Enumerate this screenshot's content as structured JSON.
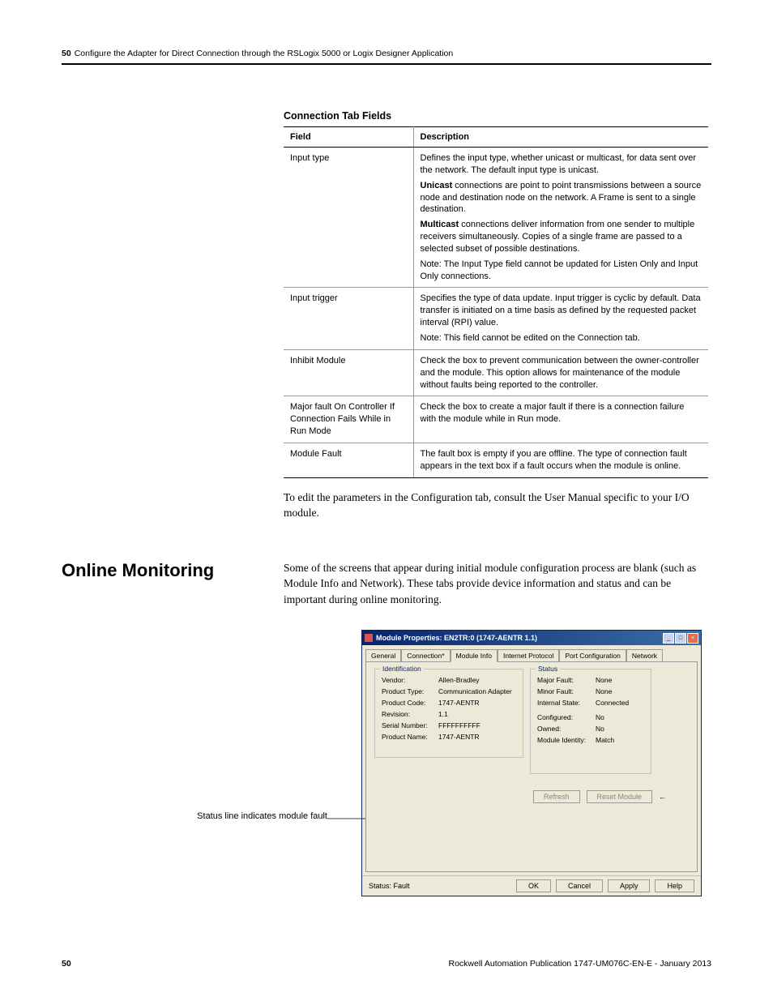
{
  "header": {
    "page_num": "50",
    "chapter": "Configure the Adapter for Direct Connection through the RSLogix 5000 or Logix Designer Application"
  },
  "table": {
    "caption": "Connection Tab Fields",
    "head": {
      "field": "Field",
      "desc": "Description"
    },
    "rows": [
      {
        "field": "Input type",
        "desc": [
          "Defines the input type, whether unicast or multicast, for data sent over the network. The default input type is unicast.",
          "<b>Unicast</b> connections are point to point transmissions between a source node and destination node on the network. A Frame is sent to a single destination.",
          "<b>Multicast</b> connections deliver information from one sender to multiple receivers simultaneously. Copies of a single frame are passed to a selected subset of possible destinations.",
          "Note: The Input Type field cannot be updated for Listen Only and Input Only connections."
        ]
      },
      {
        "field": "Input trigger",
        "desc": [
          "Specifies the type of data update. Input trigger is cyclic by default. Data transfer is initiated on a time basis as defined by the requested packet interval (RPI) value.",
          "Note: This field cannot be edited on the Connection tab."
        ]
      },
      {
        "field": "Inhibit Module",
        "desc": [
          "Check the box to prevent communication between the owner-controller and the module. This option allows for maintenance of the module without faults being reported to the controller."
        ]
      },
      {
        "field": "Major fault On Controller If Connection Fails While in Run Mode",
        "desc": [
          "Check the box to create a major fault if there is a connection failure with the module while in Run mode."
        ]
      },
      {
        "field": "Module Fault",
        "desc": [
          "The fault box is empty if you are offline. The type of connection fault appears in the text box if a fault occurs when the module is online."
        ]
      }
    ]
  },
  "body1": "To edit the parameters in the Configuration tab, consult the User Manual specific to your I/O module.",
  "section": {
    "heading": "Online Monitoring",
    "body": "Some of the screens that appear during initial module configuration process are blank (such as Module Info and Network). These tabs provide device information and status and can be important during online monitoring."
  },
  "dialog": {
    "title": "Module Properties: EN2TR:0 (1747-AENTR 1.1)",
    "tabs": [
      "General",
      "Connection*",
      "Module Info",
      "Internet Protocol",
      "Port Configuration",
      "Network"
    ],
    "active_tab": 2,
    "ident": {
      "title": "Identification",
      "rows": [
        {
          "k": "Vendor:",
          "v": "Allen-Bradley"
        },
        {
          "k": "Product Type:",
          "v": "Communication Adapter"
        },
        {
          "k": "Product Code:",
          "v": "1747-AENTR"
        },
        {
          "k": "Revision:",
          "v": "1.1"
        },
        {
          "k": "Serial Number:",
          "v": "FFFFFFFFFF"
        },
        {
          "k": "Product Name:",
          "v": "1747-AENTR"
        }
      ]
    },
    "status": {
      "title": "Status",
      "rows": [
        {
          "k": "Major Fault:",
          "v": "None"
        },
        {
          "k": "Minor Fault:",
          "v": "None"
        },
        {
          "k": "Internal State:",
          "v": "Connected"
        },
        {
          "k": "",
          "v": ""
        },
        {
          "k": "Configured:",
          "v": "No"
        },
        {
          "k": "Owned:",
          "v": "No"
        },
        {
          "k": "Module Identity:",
          "v": "Match"
        }
      ]
    },
    "refresh": "Refresh",
    "reset": "Reset Module",
    "status_line": "Status: Fault",
    "ok": "OK",
    "cancel": "Cancel",
    "apply": "Apply",
    "help": "Help"
  },
  "callout": "Status line indicates module fault",
  "footer": {
    "page": "50",
    "pub": "Rockwell Automation Publication 1747-UM076C-EN-E - January 2013"
  }
}
